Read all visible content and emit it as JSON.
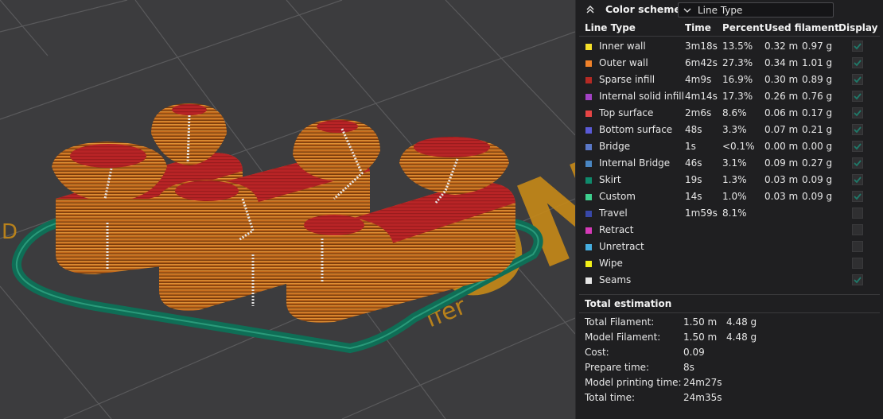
{
  "viewport": {
    "bed_logo_text": "ON",
    "bed_brand_text": "ffer",
    "bed_side_text": "D"
  },
  "panel": {
    "title": "Color scheme",
    "scheme_value": "Line Type",
    "columns": {
      "line_type": "Line Type",
      "time": "Time",
      "percent": "Percent",
      "used_filament": "Used filament",
      "display": "Display"
    },
    "rows": [
      {
        "name": "Inner wall",
        "color": "#f5e02a",
        "time": "3m18s",
        "percent": "13.5%",
        "length": "0.32 m",
        "weight": "0.97 g",
        "display": true
      },
      {
        "name": "Outer wall",
        "color": "#f0822a",
        "time": "6m42s",
        "percent": "27.3%",
        "length": "0.34 m",
        "weight": "1.01 g",
        "display": true
      },
      {
        "name": "Sparse infill",
        "color": "#b52a24",
        "time": "4m9s",
        "percent": "16.9%",
        "length": "0.30 m",
        "weight": "0.89 g",
        "display": true
      },
      {
        "name": "Internal solid infill",
        "color": "#a342c4",
        "time": "4m14s",
        "percent": "17.3%",
        "length": "0.26 m",
        "weight": "0.76 g",
        "display": true
      },
      {
        "name": "Top surface",
        "color": "#e64545",
        "time": "2m6s",
        "percent": "8.6%",
        "length": "0.06 m",
        "weight": "0.17 g",
        "display": true
      },
      {
        "name": "Bottom surface",
        "color": "#5a5ad6",
        "time": "48s",
        "percent": "3.3%",
        "length": "0.07 m",
        "weight": "0.21 g",
        "display": true
      },
      {
        "name": "Bridge",
        "color": "#5a78c8",
        "time": "1s",
        "percent": "<0.1%",
        "length": "0.00 m",
        "weight": "0.00 g",
        "display": true
      },
      {
        "name": "Internal Bridge",
        "color": "#4a86c2",
        "time": "46s",
        "percent": "3.1%",
        "length": "0.09 m",
        "weight": "0.27 g",
        "display": true
      },
      {
        "name": "Skirt",
        "color": "#0f8a6c",
        "time": "19s",
        "percent": "1.3%",
        "length": "0.03 m",
        "weight": "0.09 g",
        "display": true
      },
      {
        "name": "Custom",
        "color": "#3ecf8e",
        "time": "14s",
        "percent": "1.0%",
        "length": "0.03 m",
        "weight": "0.09 g",
        "display": true
      },
      {
        "name": "Travel",
        "color": "#3848a8",
        "time": "1m59s",
        "percent": "8.1%",
        "length": "",
        "weight": "",
        "display": false
      },
      {
        "name": "Retract",
        "color": "#d63ab8",
        "time": "",
        "percent": "",
        "length": "",
        "weight": "",
        "display": false
      },
      {
        "name": "Unretract",
        "color": "#46aee0",
        "time": "",
        "percent": "",
        "length": "",
        "weight": "",
        "display": false
      },
      {
        "name": "Wipe",
        "color": "#f2ef18",
        "time": "",
        "percent": "",
        "length": "",
        "weight": "",
        "display": false
      },
      {
        "name": "Seams",
        "color": "#e6e6e6",
        "time": "",
        "percent": "",
        "length": "",
        "weight": "",
        "display": true
      }
    ],
    "total": {
      "title": "Total estimation",
      "items": [
        {
          "label": "Total Filament:",
          "value": "1.50 m",
          "value2": "4.48 g"
        },
        {
          "label": "Model Filament:",
          "value": "1.50 m",
          "value2": "4.48 g"
        },
        {
          "label": "Cost:",
          "value": "0.09",
          "value2": ""
        },
        {
          "label": "Prepare time:",
          "value": "8s",
          "value2": ""
        },
        {
          "label": "Model printing time:",
          "value": "24m27s",
          "value2": ""
        },
        {
          "label": "Total time:",
          "value": "24m35s",
          "value2": ""
        }
      ]
    },
    "check_color": "#1f7a6a"
  }
}
